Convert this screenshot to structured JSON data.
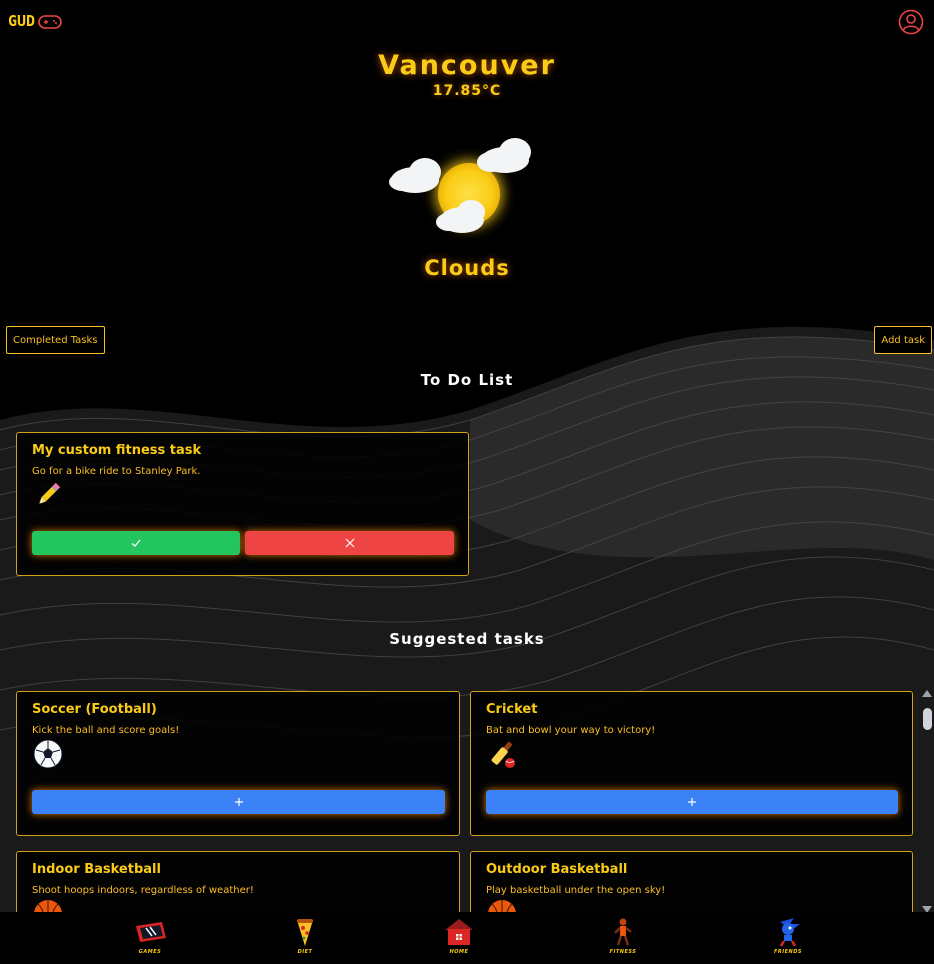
{
  "header": {
    "logo_text": "GUD",
    "logo_icon": "gamepad-icon",
    "profile_icon": "user-circle-icon"
  },
  "weather": {
    "city": "Vancouver",
    "temperature": "17.85°C",
    "icon": "sun-behind-clouds-icon",
    "condition": "Clouds"
  },
  "actions": {
    "completed_label": "Completed Tasks",
    "add_label": "Add task"
  },
  "todo": {
    "heading": "To Do List",
    "items": [
      {
        "title": "My custom fitness task",
        "description": "Go for a bike ride to Stanley Park.",
        "icon": "pencil-icon",
        "done_icon": "check-icon",
        "delete_icon": "x-icon"
      }
    ]
  },
  "suggested": {
    "heading": "Suggested tasks",
    "add_icon": "plus-icon",
    "items": [
      {
        "title": "Soccer (Football)",
        "description": "Kick the ball and score goals!",
        "icon": "soccer-ball-icon"
      },
      {
        "title": "Cricket",
        "description": "Bat and bowl your way to victory!",
        "icon": "cricket-icon"
      },
      {
        "title": "Indoor Basketball",
        "description": "Shoot hoops indoors, regardless of weather!",
        "icon": "basketball-icon"
      },
      {
        "title": "Outdoor Basketball",
        "description": "Play basketball under the open sky!",
        "icon": "basketball-icon"
      }
    ]
  },
  "nav": {
    "items": [
      {
        "label": "GAMES",
        "icon": "games-icon"
      },
      {
        "label": "DIET",
        "icon": "pizza-icon"
      },
      {
        "label": "HOME",
        "icon": "house-icon"
      },
      {
        "label": "FITNESS",
        "icon": "fitness-icon"
      },
      {
        "label": "FRIENDS",
        "icon": "friends-icon"
      }
    ]
  },
  "colors": {
    "accent": "#facc15",
    "done": "#22c55e",
    "delete": "#ef4444",
    "add": "#3b82f6",
    "background": "#000000"
  }
}
